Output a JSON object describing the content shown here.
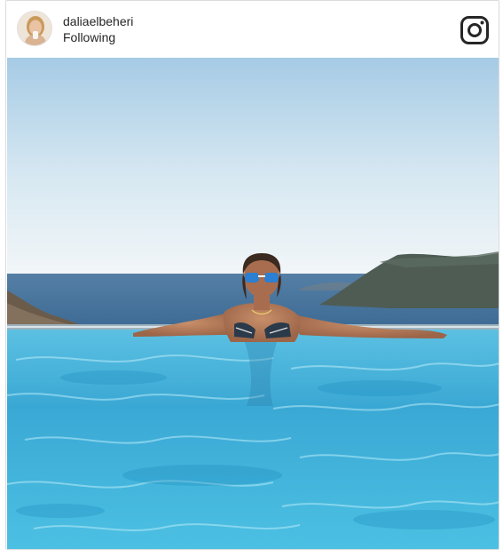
{
  "post": {
    "username": "daliaelbeheri",
    "follow_status": "Following",
    "brand_icon": "instagram-icon",
    "avatar_icon": "profile-avatar",
    "photo_description_icon": "post-photo"
  },
  "colors": {
    "border": "#dbdbdb",
    "text": "#262626",
    "sky_top": "#a9cde6",
    "sky_bottom": "#eef5f9",
    "sea": "#3d6f9a",
    "pool": "#3fb0d8"
  }
}
